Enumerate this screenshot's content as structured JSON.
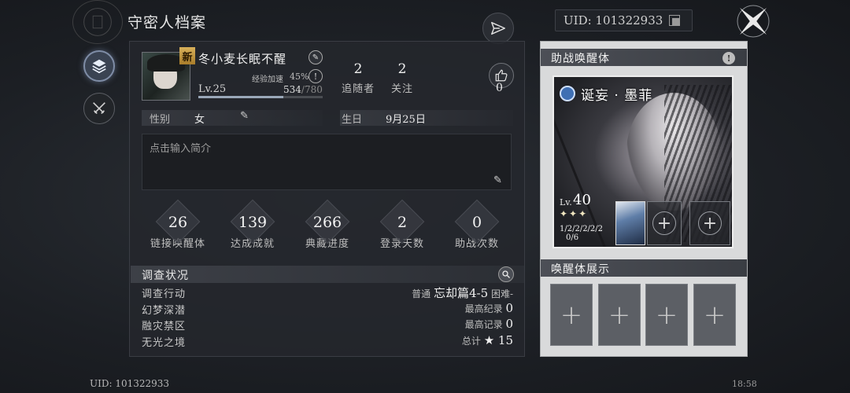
{
  "header": {
    "title": "守密人档案",
    "uid_label": "UID: 101322933"
  },
  "profile": {
    "new_badge": "新",
    "name": "冬小麦长眠不醒",
    "exp_boost_label": "经验加速",
    "exp_boost_value": "45%",
    "level": "Lv.25",
    "exp_current": "534",
    "exp_max": "/780",
    "exp_progress": 0.685,
    "followers_count": "2",
    "followers_label": "追随者",
    "following_count": "2",
    "following_label": "关注",
    "likes": "0",
    "gender_label": "性别",
    "gender_value": "女",
    "birthday_label": "生日",
    "birthday_value": "9月25日",
    "bio_placeholder": "点击输入简介"
  },
  "stats": [
    {
      "value": "26",
      "label": "链接唤醒体"
    },
    {
      "value": "139",
      "label": "达成成就"
    },
    {
      "value": "266",
      "label": "典藏进度"
    },
    {
      "value": "2",
      "label": "登录天数"
    },
    {
      "value": "0",
      "label": "助战次数"
    }
  ],
  "survey": {
    "title": "调查状况",
    "rows": [
      {
        "label": "调查行动",
        "prefix": "普通",
        "value": "忘却篇4-5",
        "suffix": "困难-"
      },
      {
        "label": "幻梦深潜",
        "prefix": "最高纪录",
        "value": "0",
        "suffix": ""
      },
      {
        "label": "融灾禁区",
        "prefix": "最高记录",
        "value": "0",
        "suffix": ""
      },
      {
        "label": "无光之境",
        "prefix": "总计",
        "value": "★ 15",
        "suffix": ""
      }
    ]
  },
  "assist": {
    "title": "助战唤醒体",
    "character_name": "诞妄 · 墨菲",
    "level_label": "Lv.",
    "level_value": "40",
    "stars": "✦✦✦",
    "ranks": "1/2/2/2/2/2",
    "sub_count": "0/6"
  },
  "showcase": {
    "title": "唤醒体展示"
  },
  "footer": {
    "uid": "UID: 101322933",
    "time": "18:58"
  },
  "icons": {
    "share": "paper-plane-icon",
    "layers": "layers-icon",
    "swords": "crossed-swords-icon",
    "like": "thumbs-up-icon",
    "search": "search-icon",
    "compass": "compass-star-icon"
  },
  "colors": {
    "accent_nav": "#7f8da6",
    "badge_gold": "#d7b05a",
    "assist_panel_bg": "#d9dadb"
  }
}
